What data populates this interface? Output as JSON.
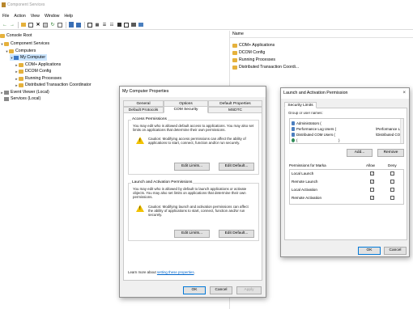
{
  "window": {
    "title": "Component Services"
  },
  "menu": [
    "File",
    "Action",
    "View",
    "Window",
    "Help"
  ],
  "toolbar_icons": [
    "back-icon",
    "forward-icon",
    "up-icon",
    "show-tree-icon",
    "delete-icon",
    "properties-icon",
    "refresh-icon",
    "export-icon",
    "help-icon",
    "view-icon",
    "large-icons-icon",
    "small-icons-icon",
    "list-icon",
    "details-icon",
    "stop-icon",
    "start-icon",
    "configure-icon",
    "msdtc-icon"
  ],
  "tree": {
    "console_root": "Console Root",
    "component_services": "Component Services",
    "computers": "Computers",
    "my_computer": "My Computer",
    "com_apps": "COM+ Applications",
    "dcom_config": "DCOM Config",
    "running_processes": "Running Processes",
    "dtc": "Distributed Transaction Coordinator",
    "event_viewer": "Event Viewer (Local)",
    "services": "Services (Local)"
  },
  "list": {
    "header": "Name",
    "items": [
      "COM+ Applications",
      "DCOM Config",
      "Running Processes",
      "Distributed Transaction Coordi..."
    ]
  },
  "props_dialog": {
    "title": "My Computer Properties",
    "tabs_row1": [
      "General",
      "Options",
      "Default Properties"
    ],
    "tabs_row2": [
      "Default Protocols",
      "COM Security",
      "MSDTC"
    ],
    "access": {
      "title": "Access Permissions",
      "desc": "You may edit who is allowed default access to applications. You may also set limits on applications that determine their own permissions.",
      "warning": "Caution: Modifying access permissions can affect the ability of applications to start, connect, function and/or run securely.",
      "edit_limits": "Edit Limits...",
      "edit_default": "Edit Default..."
    },
    "launch": {
      "title": "Launch and Activation Permissions",
      "desc": "You may edit who is allowed by default to launch applications or activate objects. You may also set limits on applications that determine their own permissions.",
      "warning": "Caution: Modifying launch and activation permissions can affect the ability of applications to start, connect, function and/or run securely.",
      "edit_limits": "Edit Limits...",
      "edit_default": "Edit Default..."
    },
    "learn_prefix": "Learn more about ",
    "learn_link": "setting these properties",
    "learn_suffix": ".",
    "ok": "OK",
    "cancel": "Cancel",
    "apply": "Apply"
  },
  "perm_dialog": {
    "title": "Launch and Activation Permission",
    "close": "×",
    "tab": "Security Limits",
    "group_label": "Group or user names:",
    "users": [
      {
        "name": "Administrators (",
        "right": ""
      },
      {
        "name": "Performance Log Users (",
        "right": "\\Performance Lc"
      },
      {
        "name": "Distributed COM Users (",
        "right": "\\Distributed COM"
      },
      {
        "name": "(",
        "right": ")"
      }
    ],
    "add": "Add...",
    "remove": "Remove",
    "perm_label": "Permissions for Marka",
    "allow": "Allow",
    "deny": "Deny",
    "permissions": [
      {
        "name": "Local Launch",
        "allow": true,
        "deny": false
      },
      {
        "name": "Remote Launch",
        "allow": true,
        "deny": false
      },
      {
        "name": "Local Activation",
        "allow": false,
        "deny": false
      },
      {
        "name": "Remote Activation",
        "allow": true,
        "deny": false
      }
    ],
    "ok": "OK",
    "cancel": "Cancel"
  }
}
